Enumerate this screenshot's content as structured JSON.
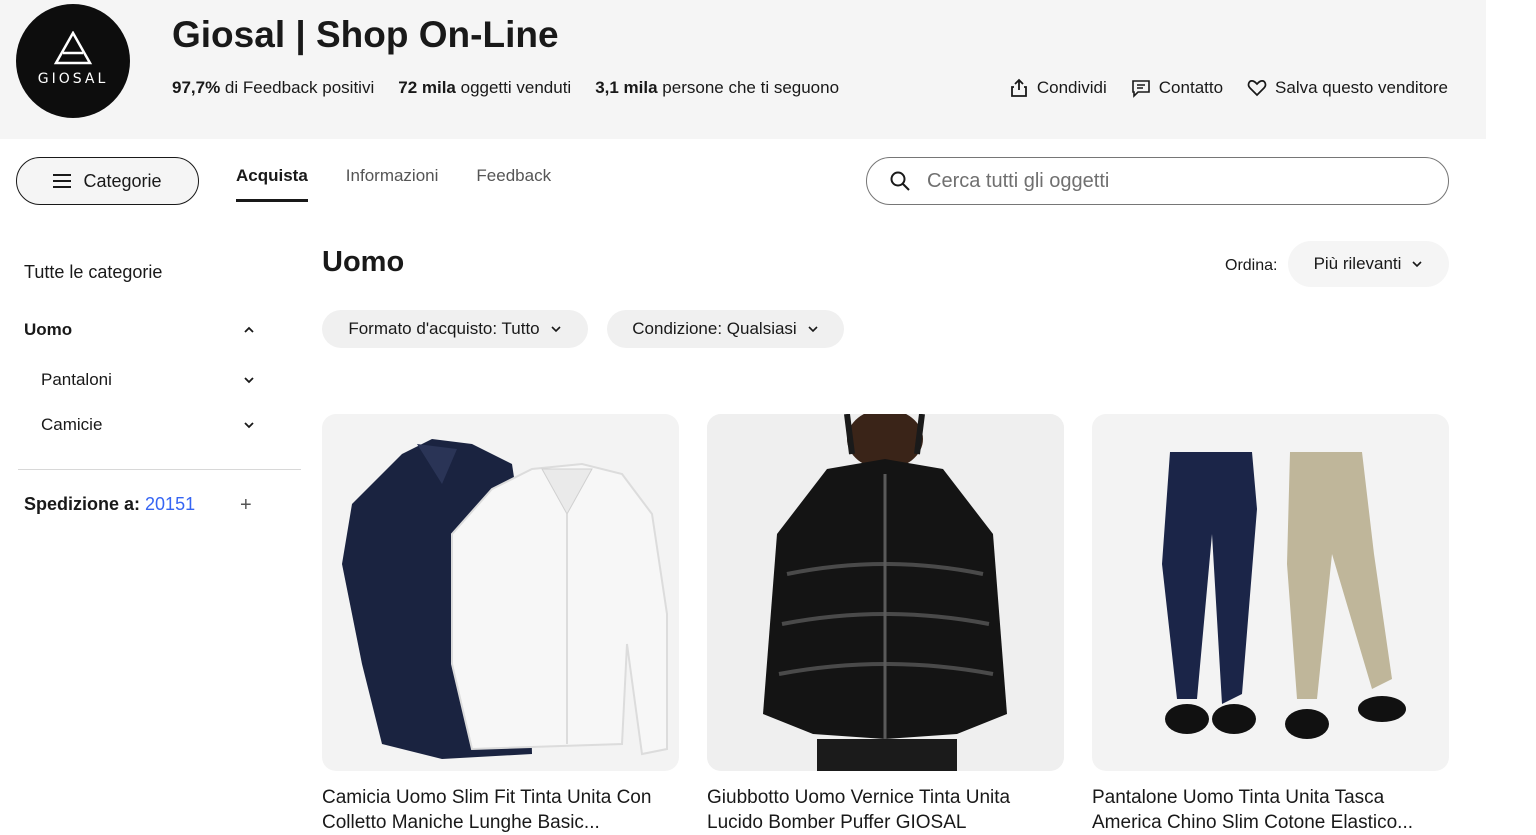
{
  "store": {
    "logo_text": "GIOSAL",
    "title": "Giosal | Shop On-Line",
    "stats": [
      {
        "value": "97,7%",
        "label": " di Feedback positivi"
      },
      {
        "value": "72 mila",
        "label": " oggetti venduti"
      },
      {
        "value": "3,1 mila",
        "label": " persone che ti seguono"
      }
    ],
    "actions": {
      "share": "Condividi",
      "contact": "Contatto",
      "save": "Salva questo venditore"
    }
  },
  "nav": {
    "categories_button": "Categorie",
    "tabs": [
      {
        "label": "Acquista",
        "active": true
      },
      {
        "label": "Informazioni",
        "active": false
      },
      {
        "label": "Feedback",
        "active": false
      }
    ],
    "search_placeholder": "Cerca tutti gli oggetti"
  },
  "sidebar": {
    "all_categories": "Tutte le categorie",
    "category": "Uomo",
    "subcategories": [
      "Pantaloni",
      "Camicie"
    ],
    "shipping_label": "Spedizione a:",
    "shipping_zip": "20151",
    "shipping_toggle": "+"
  },
  "main": {
    "title": "Uomo",
    "sort_label": "Ordina:",
    "sort_value": "Più rilevanti",
    "filters": [
      "Formato d'acquisto: Tutto",
      "Condizione: Qualsiasi"
    ]
  },
  "products": [
    {
      "title": "Camicia Uomo Slim Fit Tinta Unita Con Colletto Maniche Lunghe Basic..."
    },
    {
      "title": "Giubbotto Uomo Vernice Tinta Unita Lucido Bomber Puffer GIOSAL"
    },
    {
      "title": "Pantalone Uomo Tinta Unita Tasca America Chino Slim Cotone Elastico..."
    }
  ],
  "colors": {
    "accent_link": "#3665f3",
    "header_bg": "#f5f5f5",
    "text": "#191919"
  }
}
